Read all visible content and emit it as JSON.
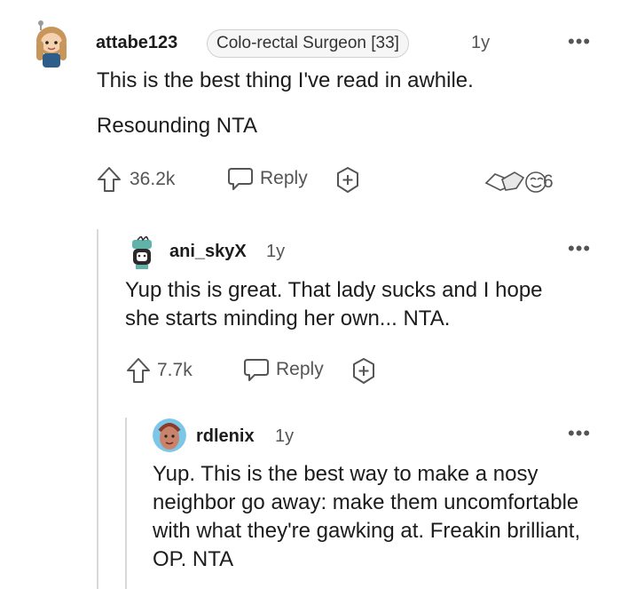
{
  "comments": [
    {
      "username": "attabe123",
      "flair": "Colo-rectal Surgeon [33]",
      "age": "1y",
      "more": "•••",
      "paragraphs": [
        "This is the best thing I've read in awhile.",
        "Resounding NTA"
      ],
      "votes": "36.2k",
      "reply_label": "Reply",
      "awards_count": "6",
      "icons": [
        "upvote-icon",
        "reply-bubble-icon",
        "award-plus-icon",
        "awards-icon"
      ]
    },
    {
      "username": "ani_skyX",
      "age": "1y",
      "more": "•••",
      "text": "Yup this is great. That lady sucks and I hope she starts minding her own... NTA.",
      "votes": "7.7k",
      "reply_label": "Reply"
    },
    {
      "username": "rdlenix",
      "age": "1y",
      "more": "•••",
      "text": "Yup. This is the best way to make a nosy neighbor go away: make them uncomfortable with what they're gawking at. Freakin brilliant, OP. NTA"
    }
  ],
  "colors": {
    "text": "#1c1c1c",
    "muted": "#555555",
    "thread_line": "#d9d9d9"
  }
}
